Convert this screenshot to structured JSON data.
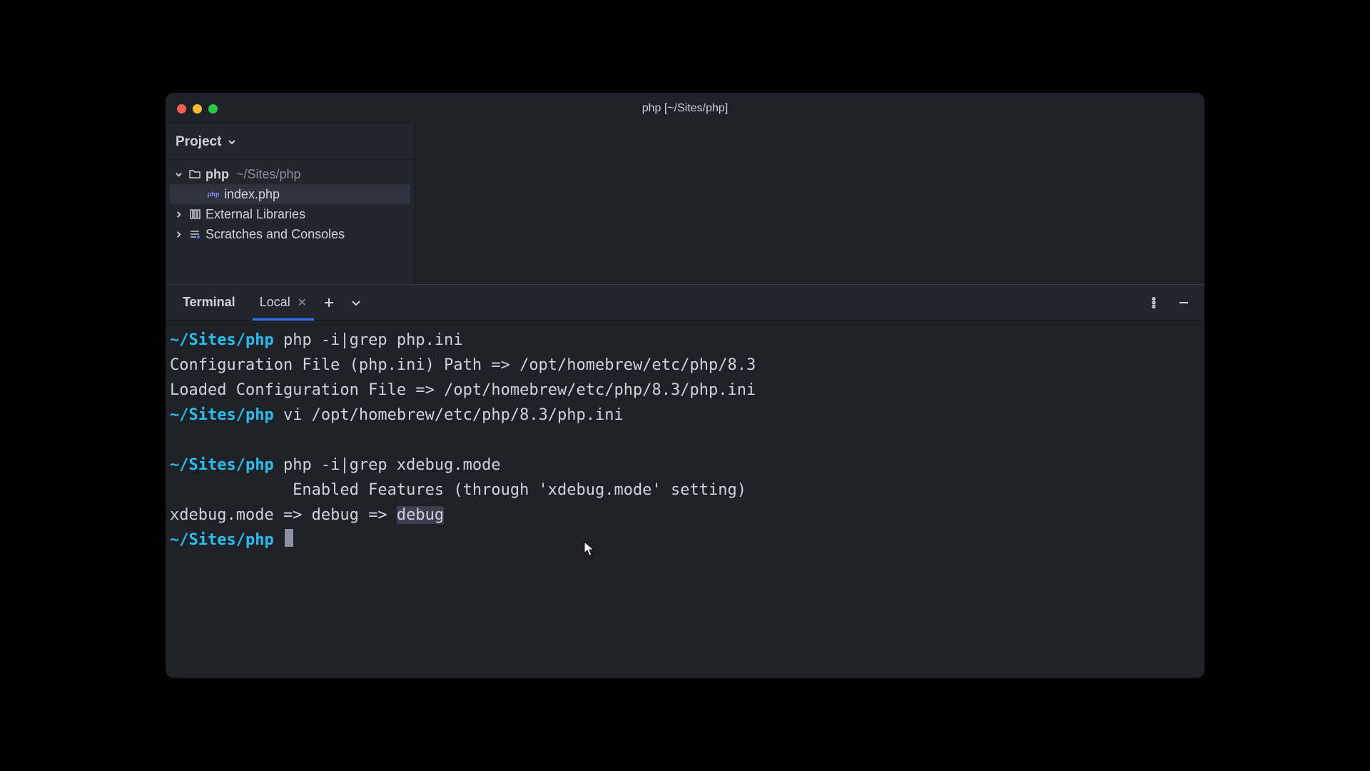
{
  "window": {
    "title": "php [~/Sites/php]"
  },
  "sidebar": {
    "header_label": "Project",
    "project_root": {
      "name": "php",
      "path": "~/Sites/php"
    },
    "file": {
      "name": "index.php"
    },
    "external_libs_label": "External Libraries",
    "scratches_label": "Scratches and Consoles"
  },
  "terminal_panel": {
    "main_tab_label": "Terminal",
    "session_tab_label": "Local"
  },
  "terminal": {
    "prompt_path": "~/Sites/php",
    "lines": [
      {
        "type": "cmd",
        "text": "php -i|grep php.ini"
      },
      {
        "type": "out",
        "text": "Configuration File (php.ini) Path => /opt/homebrew/etc/php/8.3"
      },
      {
        "type": "out",
        "text": "Loaded Configuration File => /opt/homebrew/etc/php/8.3/php.ini"
      },
      {
        "type": "cmd",
        "text": "vi /opt/homebrew/etc/php/8.3/php.ini"
      },
      {
        "type": "blank",
        "text": ""
      },
      {
        "type": "cmd",
        "text": "php -i|grep xdebug.mode"
      },
      {
        "type": "out",
        "text": "             Enabled Features (through 'xdebug.mode' setting)"
      },
      {
        "type": "out_sel",
        "text_before": "xdebug.mode => debug => ",
        "text_sel": "debug"
      },
      {
        "type": "prompt_cursor"
      }
    ]
  },
  "colors": {
    "accent": "#3574F0",
    "prompt": "#2bbdeb"
  }
}
